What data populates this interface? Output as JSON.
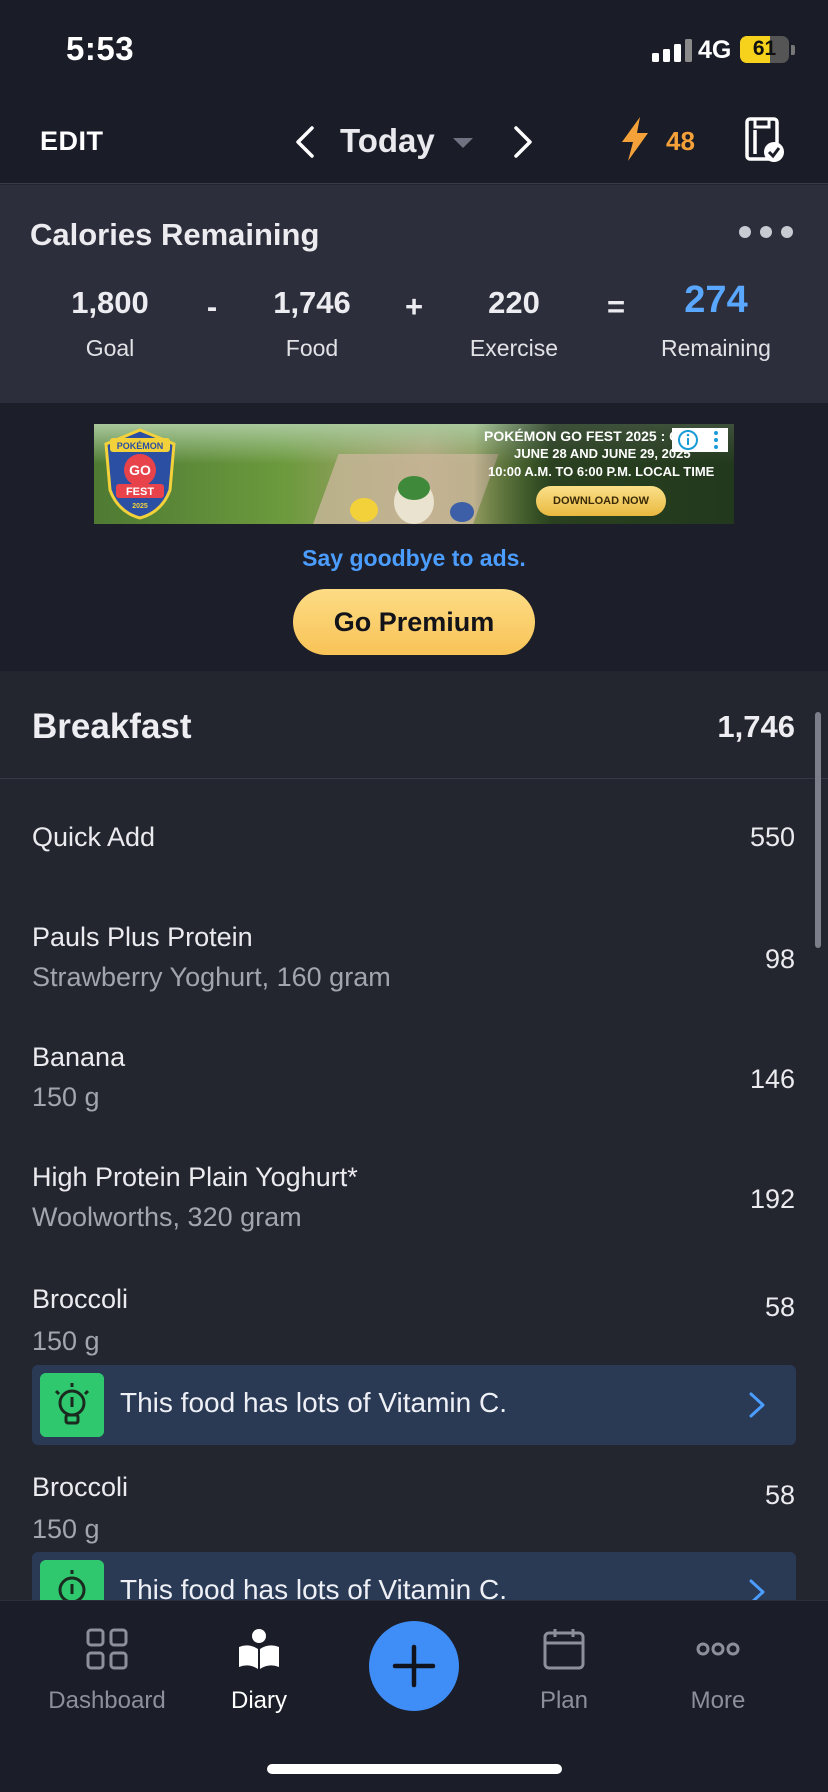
{
  "status_bar": {
    "time": "5:53",
    "network": "4G",
    "battery": "61",
    "battery_level": 0.61
  },
  "header": {
    "edit_label": "EDIT",
    "date_label": "Today",
    "streak_count": "48",
    "icons": [
      "chevron-left-icon",
      "chevron-down-icon",
      "chevron-right-icon",
      "lightning-icon",
      "checklist-icon"
    ]
  },
  "calories": {
    "title": "Calories Remaining",
    "goal_value": "1,800",
    "goal_label": "Goal",
    "op_minus": "-",
    "food_value": "1,746",
    "food_label": "Food",
    "op_plus": "+",
    "exercise_value": "220",
    "exercise_label": "Exercise",
    "op_equals": "=",
    "remaining_value": "274",
    "remaining_label": "Remaining"
  },
  "ad": {
    "line1": "POKÉMON GO FEST 2025 : G",
    "line2": "JUNE 28 AND JUNE 29, 2025",
    "line3": "10:00 A.M. TO 6:00 P.M. LOCAL TIME",
    "cta": "DOWNLOAD NOW",
    "logo_text": [
      "POKÉMON",
      "GO",
      "FEST",
      "2025"
    ],
    "goodbye_text": "Say goodbye to ads.",
    "premium_label": "Go Premium"
  },
  "meal": {
    "title": "Breakfast",
    "total": "1,746",
    "entries": [
      {
        "name": "Quick Add",
        "sub": "",
        "cal": "550"
      },
      {
        "name": "Pauls Plus Protein",
        "sub": "Strawberry Yoghurt, 160 gram",
        "cal": "98"
      },
      {
        "name": "Banana",
        "sub": "150 g",
        "cal": "146"
      },
      {
        "name": "High Protein Plain Yoghurt*",
        "sub": "Woolworths, 320 gram",
        "cal": "192"
      },
      {
        "name": "Broccoli",
        "sub": "150 g",
        "cal": "58",
        "insight": "This food has lots of Vitamin C."
      },
      {
        "name": "Broccoli",
        "sub": "150 g",
        "cal": "58",
        "insight": "This food has lots of Vitamin C."
      }
    ]
  },
  "tabs": [
    {
      "label": "Dashboard",
      "icon": "dashboard-icon",
      "active": false
    },
    {
      "label": "Diary",
      "icon": "diary-icon",
      "active": true
    },
    {
      "label": "Plan",
      "icon": "calendar-icon",
      "active": false
    },
    {
      "label": "More",
      "icon": "more-icon",
      "active": false
    }
  ],
  "colors": {
    "accent_blue": "#3f8ef7",
    "remaining_blue": "#5aa7ff",
    "streak_orange": "#f4a13a",
    "premium_yellow": "#f8c357",
    "insight_green": "#2fc86f"
  }
}
